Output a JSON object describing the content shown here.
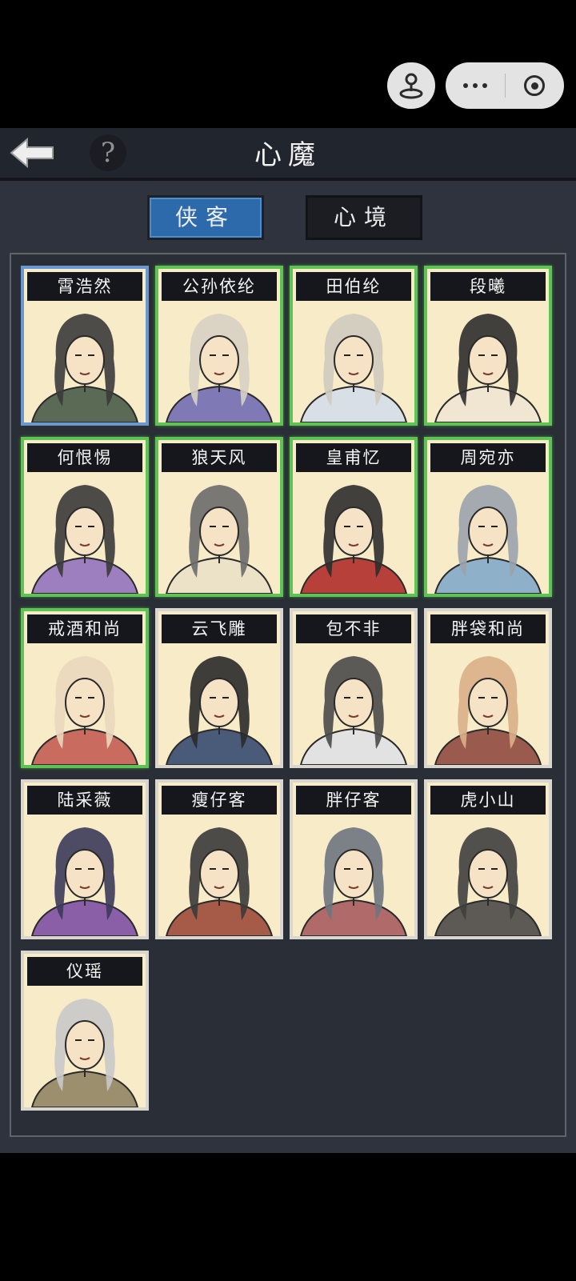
{
  "top_menu": {
    "game_icon": "joystick-icon",
    "more_icon": "ellipsis-icon",
    "close_icon": "target-icon"
  },
  "header": {
    "title": "心魔",
    "help_label": "?",
    "back_icon": "back-arrow-icon"
  },
  "tabs": [
    {
      "label": "侠客",
      "active": true
    },
    {
      "label": "心境",
      "active": false
    }
  ],
  "colors": {
    "green_frame": "#5ec255",
    "blue_frame": "#6b97d0",
    "gray_frame": "#d8d6cf",
    "tab_active": "#2c6aab",
    "card_bg": "#f7ebc8"
  },
  "characters": [
    {
      "name": "霄浩然",
      "frame": "blue"
    },
    {
      "name": "公孙依纶",
      "frame": "green"
    },
    {
      "name": "田伯纶",
      "frame": "green"
    },
    {
      "name": "段曦",
      "frame": "green"
    },
    {
      "name": "何恨惕",
      "frame": "green"
    },
    {
      "name": "狼天风",
      "frame": "green"
    },
    {
      "name": "皇甫忆",
      "frame": "green"
    },
    {
      "name": "周宛亦",
      "frame": "green"
    },
    {
      "name": "戒酒和尚",
      "frame": "green"
    },
    {
      "name": "云飞雕",
      "frame": "gray"
    },
    {
      "name": "包不非",
      "frame": "gray"
    },
    {
      "name": "胖袋和尚",
      "frame": "gray"
    },
    {
      "name": "陆采薇",
      "frame": "gray"
    },
    {
      "name": "瘦仔客",
      "frame": "gray"
    },
    {
      "name": "胖仔客",
      "frame": "gray"
    },
    {
      "name": "虎小山",
      "frame": "gray"
    },
    {
      "name": "仪瑶",
      "frame": "gray"
    }
  ]
}
